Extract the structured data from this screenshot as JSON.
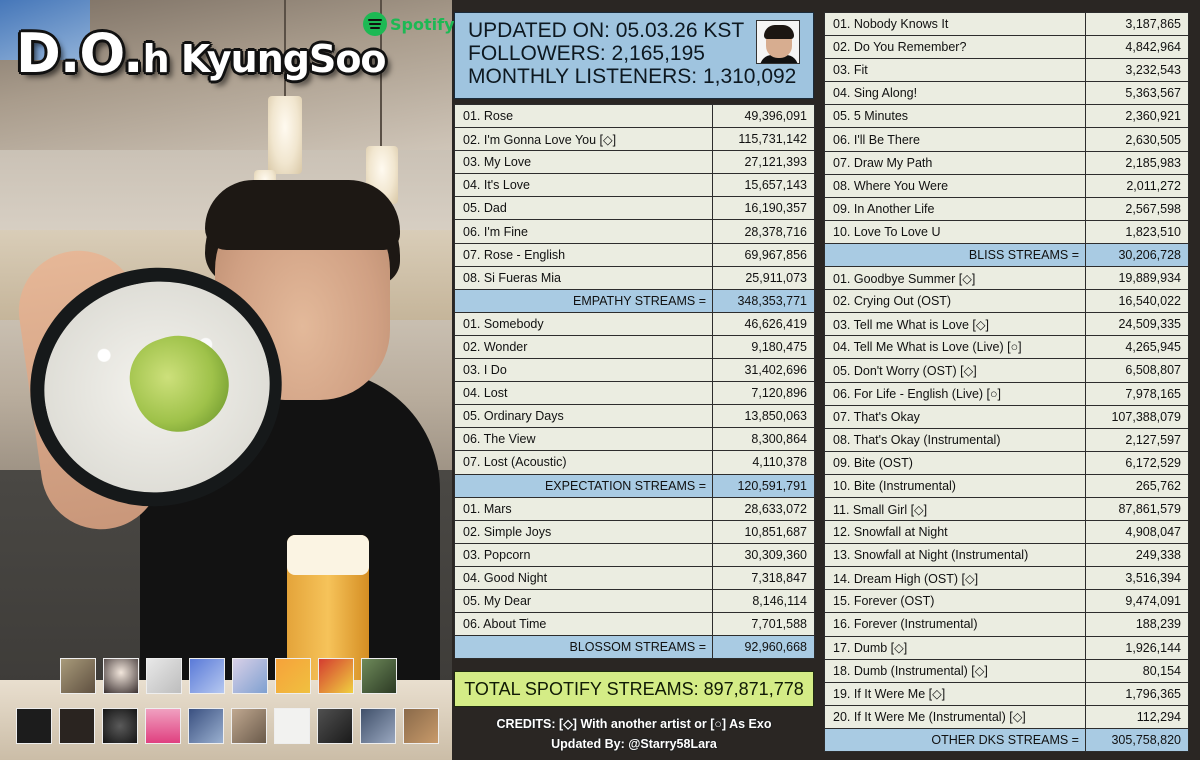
{
  "header": {
    "artist_first": "D.O.",
    "artist_rest": "h KyungSoo",
    "spotify_label": "Spotify"
  },
  "info": {
    "updated": "UPDATED ON: 05.03.26 KST",
    "followers": "FOLLOWERS: 2,165,195",
    "monthly_listeners": "MONTHLY LISTENERS: 1,310,092"
  },
  "albums": {
    "empathy": {
      "tracks": [
        {
          "title": "01. Rose",
          "streams": "49,396,091"
        },
        {
          "title": "02. I'm Gonna Love You [◇]",
          "streams": "115,731,142"
        },
        {
          "title": "03. My Love",
          "streams": "27,121,393"
        },
        {
          "title": "04. It's Love",
          "streams": "15,657,143"
        },
        {
          "title": "05. Dad",
          "streams": "16,190,357"
        },
        {
          "title": "06. I'm Fine",
          "streams": "28,378,716"
        },
        {
          "title": "07. Rose - English",
          "streams": "69,967,856"
        },
        {
          "title": "08. Si Fueras Mia",
          "streams": "25,911,073"
        }
      ],
      "total_label": "EMPATHY STREAMS =",
      "total": "348,353,771"
    },
    "expectation": {
      "tracks": [
        {
          "title": "01. Somebody",
          "streams": "46,626,419"
        },
        {
          "title": "02. Wonder",
          "streams": "9,180,475"
        },
        {
          "title": "03. I Do",
          "streams": "31,402,696"
        },
        {
          "title": "04. Lost",
          "streams": "7,120,896"
        },
        {
          "title": "05. Ordinary Days",
          "streams": "13,850,063"
        },
        {
          "title": "06. The View",
          "streams": "8,300,864"
        },
        {
          "title": "07. Lost (Acoustic)",
          "streams": "4,110,378"
        }
      ],
      "total_label": "EXPECTATION STREAMS =",
      "total": "120,591,791"
    },
    "blossom": {
      "tracks": [
        {
          "title": "01. Mars",
          "streams": "28,633,072"
        },
        {
          "title": "02. Simple Joys",
          "streams": "10,851,687"
        },
        {
          "title": "03. Popcorn",
          "streams": "30,309,360"
        },
        {
          "title": "04. Good Night",
          "streams": "7,318,847"
        },
        {
          "title": "05. My Dear",
          "streams": "8,146,114"
        },
        {
          "title": "06. About Time",
          "streams": "7,701,588"
        }
      ],
      "total_label": "BLOSSOM STREAMS =",
      "total": "92,960,668"
    },
    "bliss": {
      "tracks": [
        {
          "title": "01. Nobody Knows It",
          "streams": "3,187,865"
        },
        {
          "title": "02. Do You Remember?",
          "streams": "4,842,964"
        },
        {
          "title": "03. Fit",
          "streams": "3,232,543"
        },
        {
          "title": "04. Sing Along!",
          "streams": "5,363,567"
        },
        {
          "title": "05. 5 Minutes",
          "streams": "2,360,921"
        },
        {
          "title": "06. I'll Be There",
          "streams": "2,630,505"
        },
        {
          "title": "07. Draw My Path",
          "streams": "2,185,983"
        },
        {
          "title": "08. Where You Were",
          "streams": "2,011,272"
        },
        {
          "title": "09. In Another Life",
          "streams": "2,567,598"
        },
        {
          "title": "10. Love To Love U",
          "streams": "1,823,510"
        }
      ],
      "total_label": "BLISS STREAMS =",
      "total": "30,206,728"
    },
    "other": {
      "tracks": [
        {
          "title": "01. Goodbye Summer [◇]",
          "streams": "19,889,934"
        },
        {
          "title": "02. Crying Out (OST)",
          "streams": "16,540,022"
        },
        {
          "title": "03. Tell me What is Love [◇]",
          "streams": "24,509,335"
        },
        {
          "title": "04. Tell Me What is Love (Live) [○]",
          "streams": "4,265,945"
        },
        {
          "title": "05. Don't Worry (OST) [◇]",
          "streams": "6,508,807"
        },
        {
          "title": "06. For Life - English (Live) [○]",
          "streams": "7,978,165"
        },
        {
          "title": "07. That's Okay",
          "streams": "107,388,079"
        },
        {
          "title": "08. That's Okay (Instrumental)",
          "streams": "2,127,597"
        },
        {
          "title": "09. Bite (OST)",
          "streams": "6,172,529"
        },
        {
          "title": "10. Bite (Instrumental)",
          "streams": "265,762"
        },
        {
          "title": "11. Small Girl [◇]",
          "streams": "87,861,579"
        },
        {
          "title": "12. Snowfall at Night",
          "streams": "4,908,047"
        },
        {
          "title": "13. Snowfall at Night (Instrumental)",
          "streams": "249,338"
        },
        {
          "title": "14. Dream High (OST) [◇]",
          "streams": "3,516,394"
        },
        {
          "title": "15. Forever (OST)",
          "streams": "9,474,091"
        },
        {
          "title": "16. Forever (Instrumental)",
          "streams": "188,239"
        },
        {
          "title": "17. Dumb [◇]",
          "streams": "1,926,144"
        },
        {
          "title": "18. Dumb (Instrumental) [◇]",
          "streams": "80,154"
        },
        {
          "title": "19. If It Were Me [◇]",
          "streams": "1,796,365"
        },
        {
          "title": "20. If It Were Me (Instrumental) [◇]",
          "streams": "112,294"
        }
      ],
      "total_label": "OTHER DKS STREAMS =",
      "total": "305,758,820"
    }
  },
  "total": "TOTAL SPOTIFY STREAMS: 897,871,778",
  "credits": {
    "line1": "CREDITS: [◇] With another artist or [○] As Exo",
    "line2": "Updated By: @Starry58Lara"
  },
  "colors": {
    "row_bg": "#ebede1",
    "total_row_bg": "#a9cbe3",
    "info_bg": "#9fc4df",
    "grand_total_bg": "#d4ec86",
    "spotify_green": "#1db954"
  },
  "icons": {
    "spotify": "spotify-logo-icon",
    "avatar": "artist-avatar-icon"
  }
}
